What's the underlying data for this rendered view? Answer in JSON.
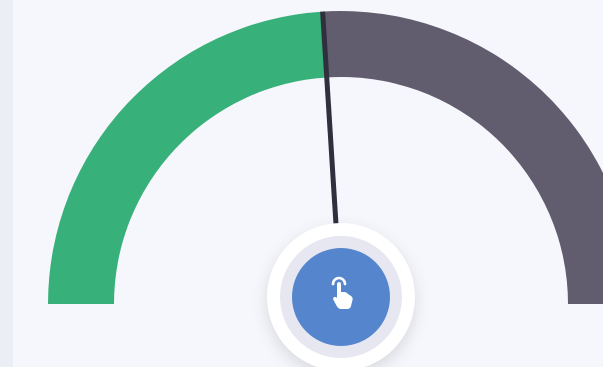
{
  "gauge": {
    "value_fraction": 0.48,
    "segments": [
      {
        "name": "filled",
        "fraction": 0.48,
        "color": "#38b07a"
      },
      {
        "name": "remaining",
        "fraction": 0.52,
        "color": "#625d6e"
      }
    ],
    "needle_color": "#2f2f3d"
  },
  "knob": {
    "icon": "tap-hand-icon",
    "inner_color": "#5485cd",
    "ring_color": "#e7e7f1",
    "outer_color": "#ffffff"
  }
}
